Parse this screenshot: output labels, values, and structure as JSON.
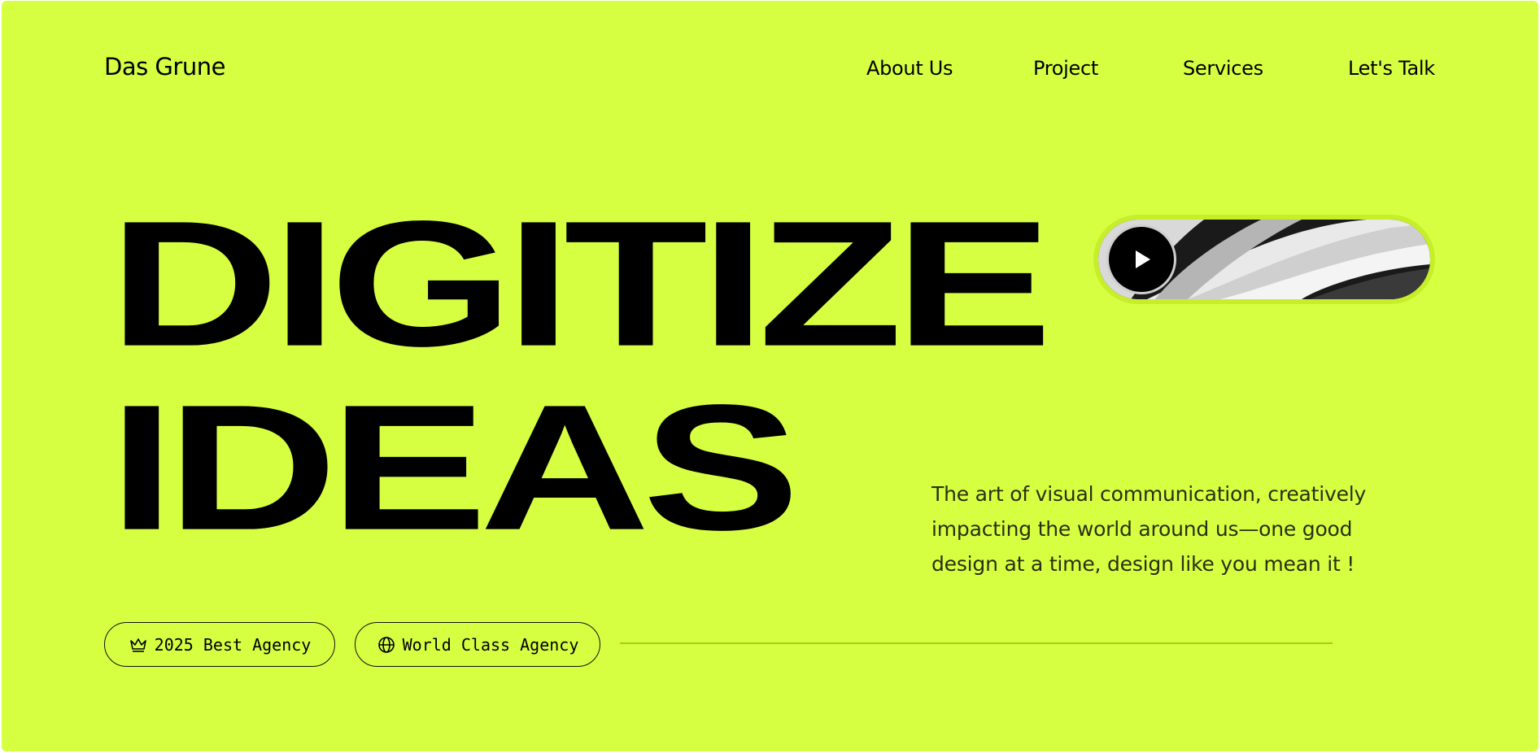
{
  "header": {
    "logo": "Das Grune",
    "nav": [
      "About Us",
      "Project",
      "Services",
      "Let's Talk"
    ]
  },
  "hero": {
    "headline_line1": "DIGITIZE",
    "headline_line2": "IDEAS",
    "description": "The art of visual communication, creatively impacting the world around us—one good design at a time, design like you mean it !"
  },
  "video": {
    "icon": "play-icon"
  },
  "badges": [
    {
      "label": "2025 Best Agency",
      "icon": "crown-icon"
    },
    {
      "label": "World Class Agency",
      "icon": "globe-icon"
    }
  ],
  "colors": {
    "background": "#d7ff42",
    "text": "#000000",
    "divider": "#a8cc10"
  }
}
